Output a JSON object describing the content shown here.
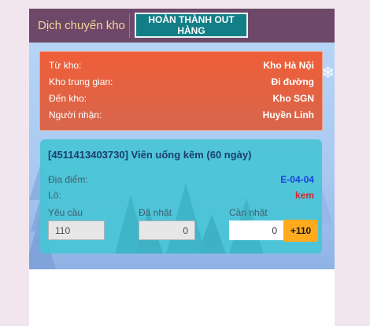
{
  "header": {
    "title": "Dịch chuyển kho",
    "complete_button": "HOÀN THÀNH OUT HÀNG"
  },
  "transfer": {
    "rows": [
      {
        "label": "Từ kho:",
        "value": "Kho Hà Nội"
      },
      {
        "label": "Kho trung gian:",
        "value": "Đi đường"
      },
      {
        "label": "Đến kho:",
        "value": "Kho SGN"
      },
      {
        "label": "Người nhận:",
        "value": "Huyền Linh"
      }
    ]
  },
  "product": {
    "title": "[4511413403730] Viên uống kẽm (60 ngày)",
    "location_label": "Địa điểm:",
    "location_value": "E-04-04",
    "lot_label": "Lô:",
    "lot_value": "kem",
    "required_label": "Yêu cầu",
    "picked_label": "Đã nhặt",
    "to_pick_label": "Cần nhặt",
    "required_value": "110",
    "picked_value": "0",
    "to_pick_value": "0",
    "plus_button": "+110"
  },
  "colors": {
    "header_bg": "#6e4868",
    "accent_button": "#127e86",
    "transfer_card": "#ef5e37",
    "product_card": "#48c4d6",
    "plus_button": "#ffaa1d"
  }
}
